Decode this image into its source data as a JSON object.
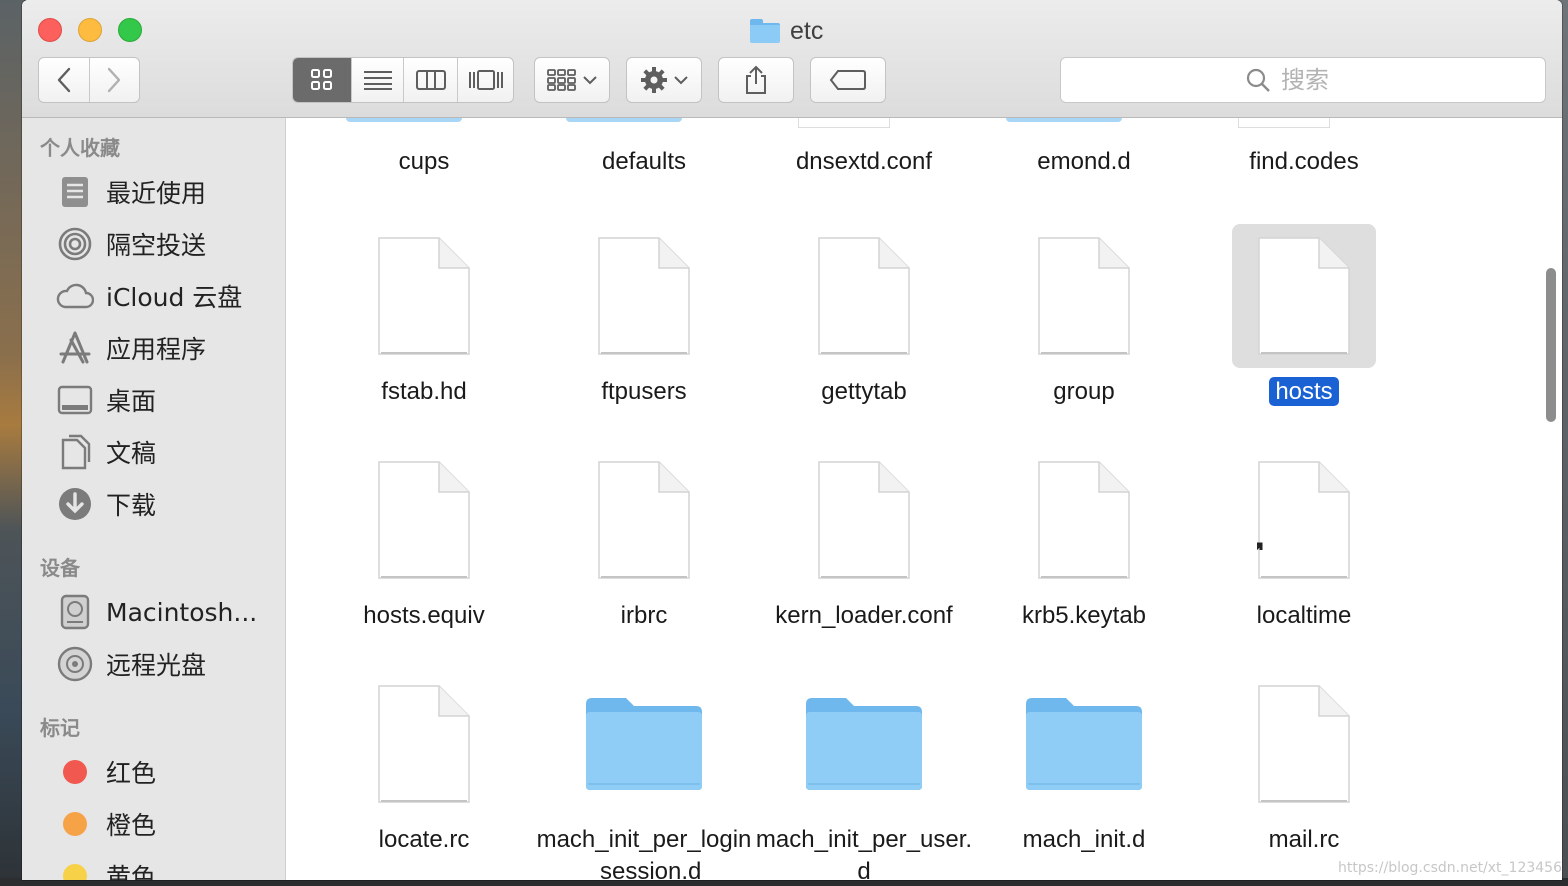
{
  "window": {
    "title": "etc"
  },
  "toolbar": {
    "back_icon": "chevron-left-icon",
    "forward_icon": "chevron-right-icon",
    "views": [
      "icon-view-icon",
      "list-view-icon",
      "column-view-icon",
      "cover-flow-icon"
    ],
    "active_view": "icon-view-icon",
    "search_placeholder": "搜索"
  },
  "sidebar": {
    "favorites_heading": "个人收藏",
    "favorites": [
      {
        "label": "最近使用",
        "icon": "recents-icon"
      },
      {
        "label": "隔空投送",
        "icon": "airdrop-icon"
      },
      {
        "label": "iCloud 云盘",
        "icon": "cloud-icon"
      },
      {
        "label": "应用程序",
        "icon": "applications-icon"
      },
      {
        "label": "桌面",
        "icon": "desktop-icon"
      },
      {
        "label": "文稿",
        "icon": "documents-icon"
      },
      {
        "label": "下载",
        "icon": "download-icon"
      }
    ],
    "devices_heading": "设备",
    "devices": [
      {
        "label": "Macintosh...",
        "icon": "hard-drive-icon"
      },
      {
        "label": "远程光盘",
        "icon": "disc-icon"
      }
    ],
    "tags_heading": "标记",
    "tags": [
      {
        "label": "红色",
        "color": "#f1584f"
      },
      {
        "label": "橙色",
        "color": "#f6a348"
      },
      {
        "label": "黄色",
        "color": "#f7d147"
      }
    ]
  },
  "files_partial_row": [
    "cups",
    "defaults",
    "dnsextd.conf",
    "emond.d",
    "find.codes"
  ],
  "files": [
    {
      "name": "fstab.hd",
      "kind": "document"
    },
    {
      "name": "ftpusers",
      "kind": "document"
    },
    {
      "name": "gettytab",
      "kind": "document"
    },
    {
      "name": "group",
      "kind": "document"
    },
    {
      "name": "hosts",
      "kind": "document",
      "selected": true
    },
    {
      "name": "hosts.equiv",
      "kind": "document"
    },
    {
      "name": "irbrc",
      "kind": "document"
    },
    {
      "name": "kern_loader.conf",
      "kind": "document"
    },
    {
      "name": "krb5.keytab",
      "kind": "document"
    },
    {
      "name": "localtime",
      "kind": "alias"
    },
    {
      "name": "locate.rc",
      "kind": "document"
    },
    {
      "name": "mach_init_per_login_session.d",
      "kind": "folder"
    },
    {
      "name": "mach_init_per_user.d",
      "kind": "folder"
    },
    {
      "name": "mach_init.d",
      "kind": "folder"
    },
    {
      "name": "mail.rc",
      "kind": "document"
    }
  ],
  "watermark": "https://blog.csdn.net/xt_123456",
  "colors": {
    "selection": "#1a62d4",
    "folder": "#8ccbf5",
    "sidebar_bg": "#e6e6e6"
  }
}
